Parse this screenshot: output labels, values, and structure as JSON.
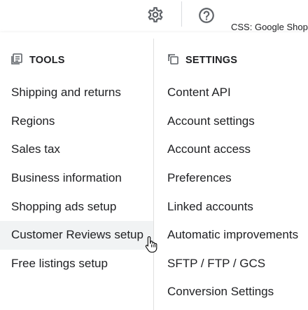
{
  "topbar": {
    "icons": [
      "gear-icon",
      "help-icon"
    ],
    "corner_label": "CSS: Google Shop"
  },
  "menu": {
    "tools": {
      "heading": "TOOLS",
      "icon": "tools-grid-icon",
      "items": [
        {
          "label": "Shipping and returns"
        },
        {
          "label": "Regions"
        },
        {
          "label": "Sales tax"
        },
        {
          "label": "Business information"
        },
        {
          "label": "Shopping ads setup"
        },
        {
          "label": "Customer Reviews setup",
          "hovered": true
        },
        {
          "label": "Free listings setup"
        }
      ]
    },
    "settings": {
      "heading": "SETTINGS",
      "icon": "settings-copy-icon",
      "items": [
        {
          "label": "Content API"
        },
        {
          "label": "Account settings"
        },
        {
          "label": "Account access"
        },
        {
          "label": "Preferences"
        },
        {
          "label": "Linked accounts"
        },
        {
          "label": "Automatic improvements"
        },
        {
          "label": "SFTP / FTP / GCS"
        },
        {
          "label": "Conversion Settings"
        }
      ]
    }
  },
  "colors": {
    "text": "#202124",
    "icon": "#5f6368",
    "hover_bg": "#f1f3f4",
    "divider": "#e0e0e0"
  }
}
